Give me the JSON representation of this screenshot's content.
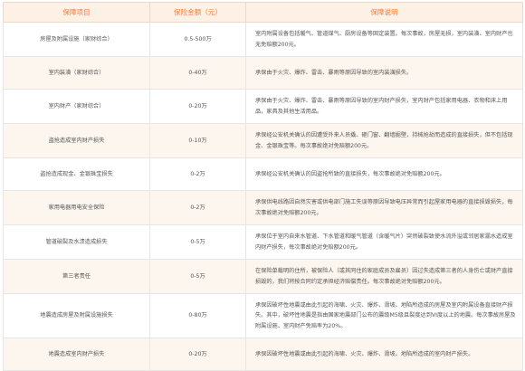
{
  "headers": {
    "item": "保障项目",
    "amount": "保险金额（元）",
    "desc": "保障说明"
  },
  "rows": [
    {
      "item": "房屋及附属设施（家财综合）",
      "amount": "0.5-500万",
      "desc": "室内附属设备包括暖气、管道煤气、厨房设备等固定装置。每次事故，房屋无损，室内装潢、室内财产也无免赔额200元。"
    },
    {
      "item": "室内装潢（家财综合）",
      "amount": "0-40万",
      "desc": "承保由于火灾、爆炸、雷击、暴雨等原因导致的室内装潢损失。"
    },
    {
      "item": "室内财产（家财综合）",
      "amount": "0-20万",
      "desc": "承保由于火灾、爆炸、雷击、暴雨等原因导致的室内财产损失，室内财产包括家用电器、衣物和床上用品，家具及其他生活用品。"
    },
    {
      "item": "盗抢造成室内财产损失",
      "amount": "0-10万",
      "desc": "承保经公安机关确认的因遭受外来人员撬、砸门窗、翻墙掘壁，持械抢劫而造成的直接损失，但不包括现金、金银珠宝等。每次事故绝对免赔额200元。"
    },
    {
      "item": "盗抢造成现金、金银珠宝损失",
      "amount": "0-2万",
      "desc": "承保经公安机关确认的因盗抢所致的直接损失，每次事故绝对免赔额200元。"
    },
    {
      "item": "家用电器用电安全保险",
      "amount": "0-2万",
      "desc": "承保供电线路因自然灾害或供电部门施工失误等原因导致电压异常而引起屋家用电器的直接损毁损失，每次事故绝对免赔额200元。"
    },
    {
      "item": "管道破裂及水渍造成损失",
      "amount": "0-5万",
      "desc": "承保位于室内自来水管道、下水管道和暖气管道（含暖气片）突然破裂致使水流外溢或邻居家漏水造成室内财产损失，每次事故绝对免赔额200元。"
    },
    {
      "item": "第三者责任",
      "amount": "0-5万",
      "desc": "在保险单载明的住所，被保险人（或其同住的家庭成员及雇员）因过失造成第三者的人身伤亡或财产直接损毁的，我们将按合同约定承担经济赔偿责任。每次事故绝对免赔额200元。"
    },
    {
      "item": "地震造成房屋及附属设施损失",
      "amount": "0-80万",
      "desc": "承保因破坏性地震或由此引起的海啸、火灾、爆炸、滑坡、地陷所造成的房屋及室内附属设备直接财产损失。其中，破坏性地震是指由国家地震部门公布的震级M5级且裂度达到VI度以上的地震。每次事故房屋及附属设施、室内财产免赔率为20%。"
    },
    {
      "item": "地震造成室内财产损失",
      "amount": "0-20万",
      "desc": "承保因破坏性地震或由此引起的海啸、火灾、爆炸、滑坡、地陷所造成的室内财产损失。"
    }
  ],
  "colors": {
    "header_text": "#f07e3c",
    "header_bg": "#fdf0e4",
    "stripe_bg": "#fdf6ef"
  }
}
